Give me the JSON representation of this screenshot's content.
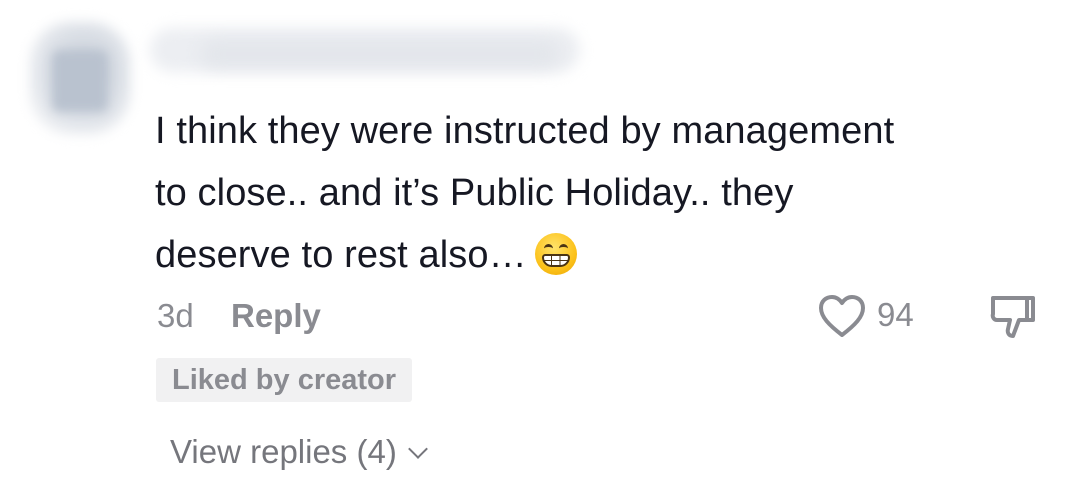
{
  "comment": {
    "author_redacted": true,
    "text_line_1": "I think they were instructed by management",
    "text_line_2": "to close.. and it’s Public Holiday.. they",
    "text_line_3": "deserve to rest also…",
    "emoji_icon": "grinning-face-with-teeth-icon"
  },
  "meta": {
    "age": "3d",
    "reply_label": "Reply",
    "like_count": "94",
    "like_icon": "heart-outline-icon",
    "dislike_icon": "thumbs-down-outline-icon"
  },
  "badge": {
    "label": "Liked by creator"
  },
  "replies": {
    "label": "View replies (4)",
    "chevron_icon": "chevron-down-icon"
  },
  "colors": {
    "text_primary": "#161823",
    "text_secondary": "#8a8b91",
    "badge_bg": "#f1f1f2"
  }
}
